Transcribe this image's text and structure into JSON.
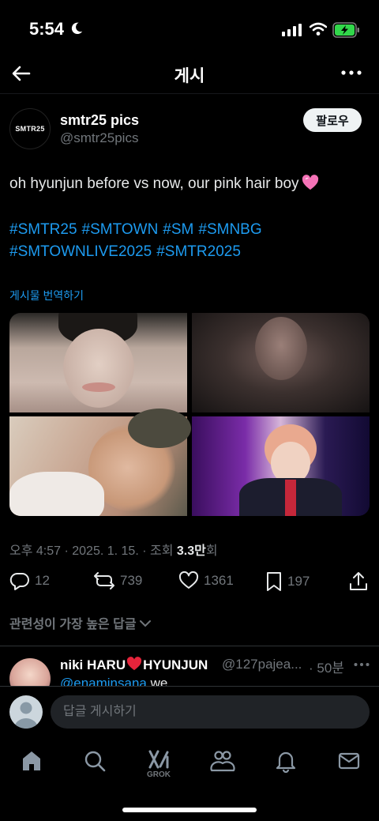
{
  "status_bar": {
    "time": "5:54"
  },
  "header": {
    "title": "게시"
  },
  "post": {
    "author_avatar_text": "SMTR25",
    "author_name": "smtr25 pics",
    "author_handle": "@smtr25pics",
    "follow_label": "팔로우",
    "text": "oh hyunjun before vs now, our pink hair boy",
    "hashtags": [
      "#SMTR25",
      "#SMTOWN",
      "#SM",
      "#SMNBG",
      "#SMTOWNLIVE2025",
      "#SMTR2025"
    ],
    "translate_label": "게시물 번역하기",
    "timestamp": "오후 4:57 · 2025. 1. 15. · 조회 ",
    "views": "3.3만",
    "views_suffix": "회",
    "counts": {
      "replies": "12",
      "reposts": "739",
      "likes": "1361",
      "bookmarks": "197"
    }
  },
  "replies_section": {
    "sort_label": "관련성이 가장 높은 답글",
    "first_reply": {
      "name": "niki HARU",
      "name_suffix": "HYUNJUN",
      "handle": "@127pajea...",
      "time": "· 50분",
      "mention": "@enaminsana",
      "text": " we"
    }
  },
  "composer": {
    "placeholder": "답글 게시하기"
  },
  "tabbar": {
    "grok_label": "GROK"
  },
  "colors": {
    "accent": "#1d9bf0",
    "background": "#000000",
    "muted": "#71767b"
  }
}
